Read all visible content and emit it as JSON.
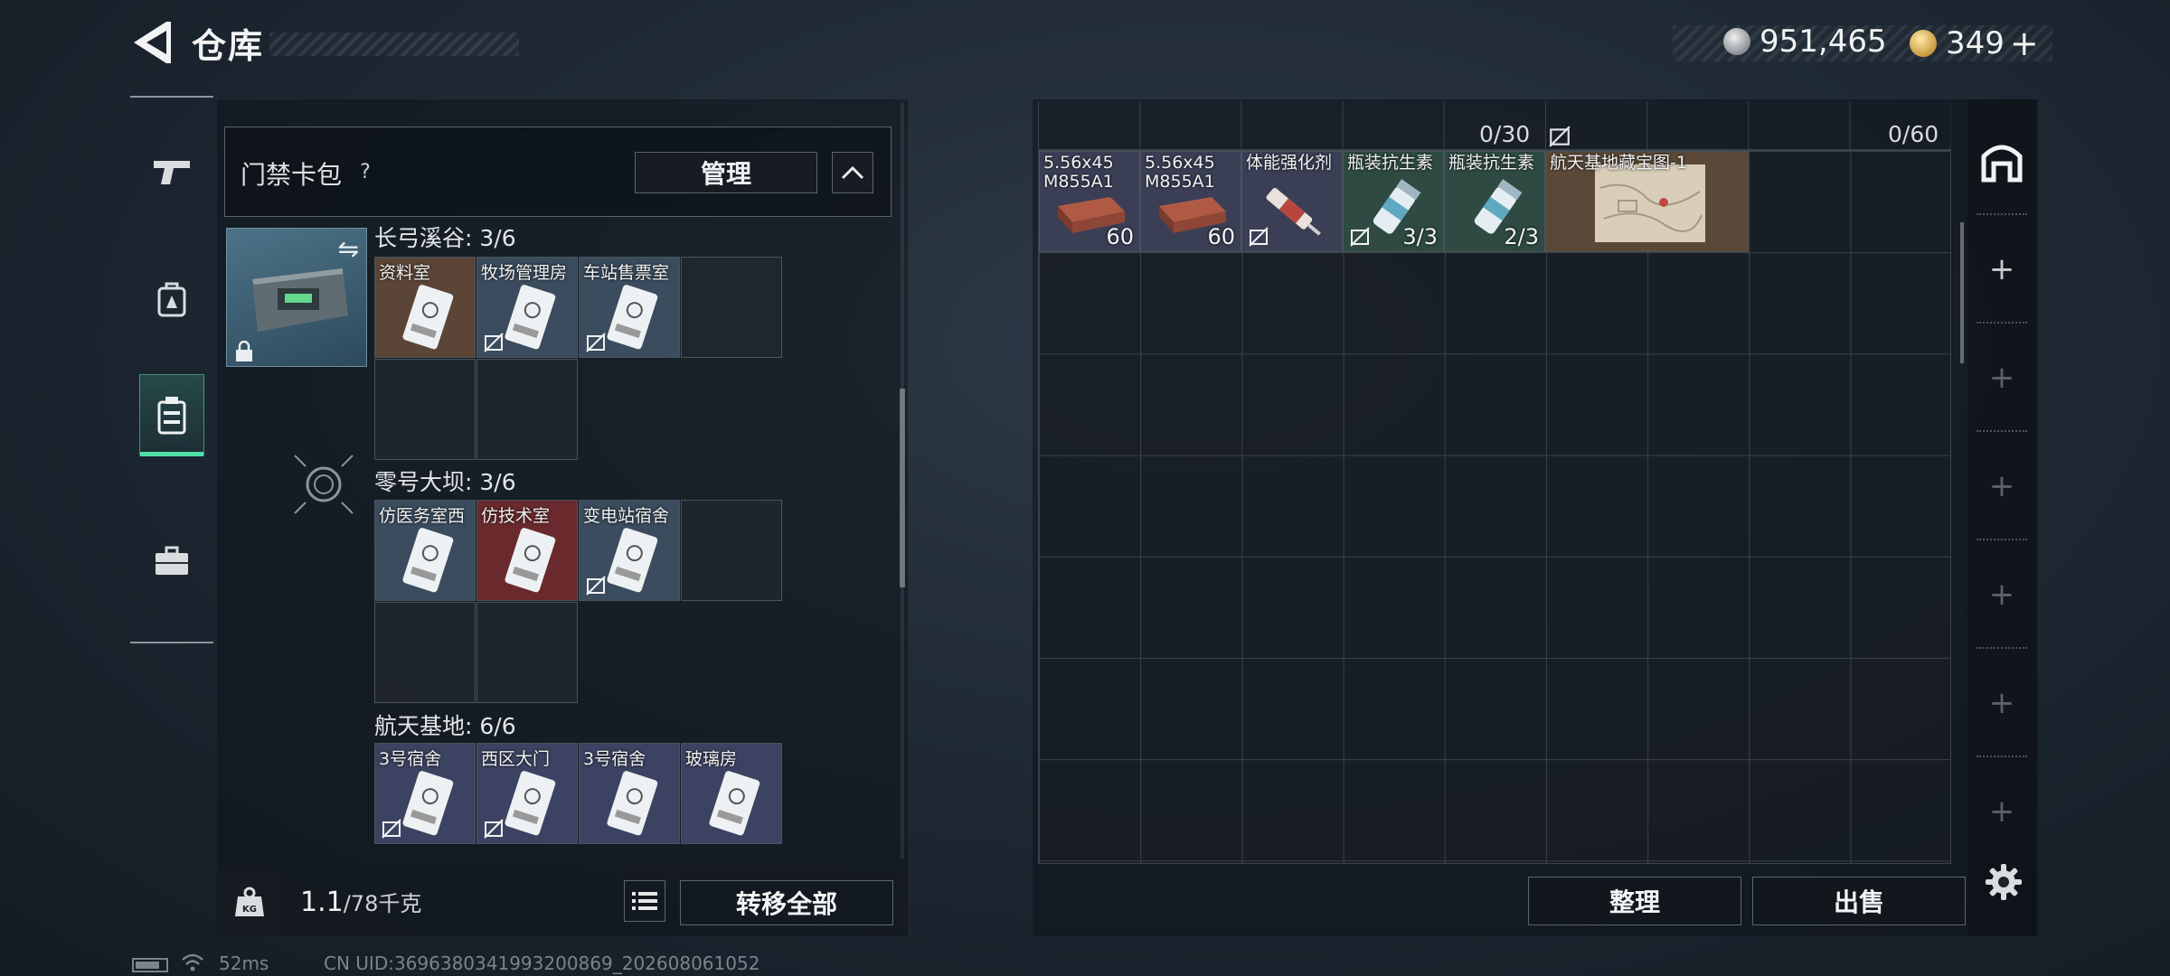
{
  "header": {
    "title": "仓库",
    "currency_silver": "951,465",
    "currency_gold": "349",
    "plus": "+"
  },
  "nav": {
    "items": [
      {
        "name": "weapons",
        "icon": "pistol-icon"
      },
      {
        "name": "equipment",
        "icon": "backpack-icon"
      },
      {
        "name": "card-holder",
        "icon": "keycard-holder-icon",
        "active": true
      },
      {
        "name": "toolbox",
        "icon": "briefcase-icon"
      }
    ]
  },
  "left": {
    "card_title": "门禁卡包",
    "help": "?",
    "manage": "管理",
    "regions": [
      {
        "label": "长弓溪谷: 3/6",
        "cards": [
          {
            "name": "资料室",
            "color": "brown",
            "no_sell": false
          },
          {
            "name": "牧场管理房",
            "color": "blue",
            "no_sell": true
          },
          {
            "name": "车站售票室",
            "color": "blue",
            "no_sell": true
          }
        ]
      },
      {
        "label": "零号大坝: 3/6",
        "cards": [
          {
            "name": "仿医务室西",
            "color": "blue",
            "no_sell": false
          },
          {
            "name": "仿技术室",
            "color": "red",
            "no_sell": false
          },
          {
            "name": "变电站宿舍",
            "color": "blue",
            "no_sell": true
          }
        ]
      },
      {
        "label": "航天基地: 6/6",
        "cards": [
          {
            "name": "3号宿舍",
            "color": "purple",
            "no_sell": true
          },
          {
            "name": "西区大门",
            "color": "purple",
            "no_sell": true
          },
          {
            "name": "3号宿舍",
            "color": "purple",
            "no_sell": false
          },
          {
            "name": "玻璃房",
            "color": "purple",
            "no_sell": false
          }
        ]
      }
    ],
    "weight_value": "1.1",
    "weight_cap": "/78千克",
    "transfer_all": "转移全部"
  },
  "right": {
    "capacity_a": "0/30",
    "capacity_b": "0/60",
    "items": [
      {
        "name_line1": "5.56x45",
        "name_line2": "M855A1",
        "count": "60",
        "bg": "#3a3f56",
        "kind": "ammo"
      },
      {
        "name_line1": "5.56x45",
        "name_line2": "M855A1",
        "count": "60",
        "bg": "#3a3f56",
        "kind": "ammo"
      },
      {
        "name_line1": "体能强化剂",
        "name_line2": "",
        "count": "",
        "bg": "#3a3f56",
        "kind": "syringe",
        "no_sell": true
      },
      {
        "name_line1": "瓶装抗生素",
        "name_line2": "",
        "count": "3/3",
        "bg": "#2e4a43",
        "kind": "bottle",
        "no_sell": true
      },
      {
        "name_line1": "瓶装抗生素",
        "name_line2": "",
        "count": "2/3",
        "bg": "#2e4a43",
        "kind": "bottle"
      },
      {
        "name_line1": "航天基地藏宝图-1",
        "name_line2": "",
        "count": "",
        "bg": "#5a4838",
        "kind": "map",
        "wide": true
      }
    ],
    "sort": "整理",
    "sell": "出售"
  },
  "status": {
    "ping": "52ms",
    "uid": "CN UID:3696380341993200869_202608061052"
  }
}
